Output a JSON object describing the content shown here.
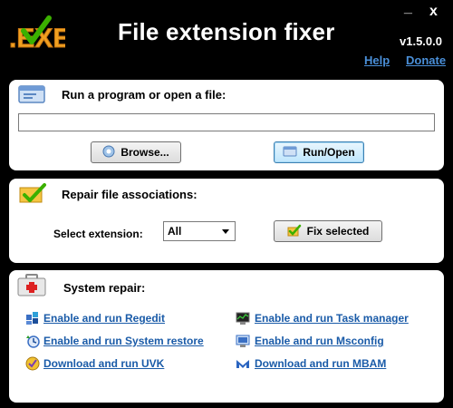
{
  "app": {
    "title": "File extension fixer",
    "version": "v1.5.0.0",
    "help_label": "Help",
    "donate_label": "Donate",
    "logo_text": ".EXE",
    "minimize_glyph": "_",
    "close_glyph": "x"
  },
  "run_panel": {
    "title": "Run a program or open a file:",
    "path_value": "",
    "browse_label": "Browse...",
    "run_label": "Run/Open"
  },
  "repair_panel": {
    "title": "Repair file associations:",
    "select_label": "Select extension:",
    "selected_extension": "All",
    "fix_label": "Fix selected"
  },
  "system_panel": {
    "title": "System repair:",
    "links": {
      "regedit": "Enable and run Regedit",
      "task_manager": "Enable and run Task manager",
      "system_restore": "Enable and run System restore",
      "msconfig": "Enable and run Msconfig",
      "uvk": "Download and run UVK",
      "mbam": "Download and run MBAM"
    }
  },
  "colors": {
    "background": "#000000",
    "panel": "#ffffff",
    "link": "#1a5ba8",
    "header_link": "#4a8fd8",
    "logo_orange": "#f0a020",
    "check_green": "#3bb000"
  }
}
